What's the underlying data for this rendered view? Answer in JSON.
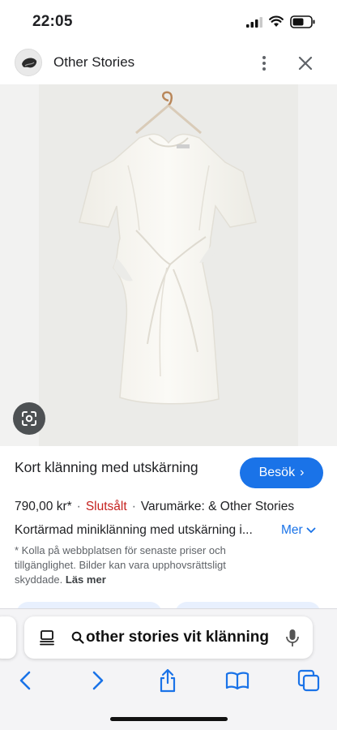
{
  "status_bar": {
    "time": "22:05"
  },
  "header": {
    "site_name": "Other Stories"
  },
  "product": {
    "title": "Kort klänning med utskärning",
    "visit_label": "Besök",
    "price": "790,00 kr*",
    "availability": "Slutsålt",
    "brand": "Varumärke: & Other Stories",
    "description": "Kortärmad miniklänning med utskärning i...",
    "more_label": "Mer",
    "disclaimer": "* Kolla på webbplatsen för senaste priser och tillgänglighet. Bilder kan vara upphovsrättsligt skyddade.",
    "read_more_label": "Läs mer"
  },
  "address_bar": {
    "text": "other stories vit klänning"
  },
  "colors": {
    "accent": "#1a73e8",
    "sold_out": "#c5221f"
  },
  "icons": [
    "signal-icon",
    "wifi-icon",
    "battery-icon",
    "site-logo",
    "more-icon",
    "close-icon",
    "lens-icon",
    "reader-icon",
    "search-icon",
    "mic-icon",
    "back-icon",
    "forward-icon",
    "share-icon",
    "bookmarks-icon",
    "tabs-icon"
  ]
}
